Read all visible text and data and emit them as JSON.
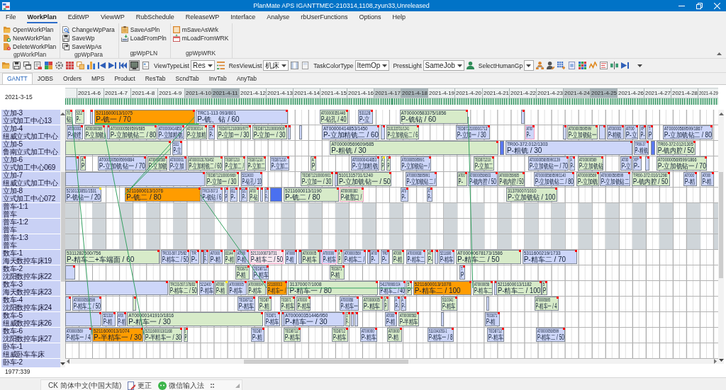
{
  "window": {
    "title": "PlanMate APS IGANTTMEC-210314,1108,zyun33,Unreleased"
  },
  "menu": [
    {
      "label": "File",
      "selected": false
    },
    {
      "label": "WorkPlan",
      "selected": true
    },
    {
      "label": "EditWP",
      "selected": false
    },
    {
      "label": "ViewWP",
      "selected": false
    },
    {
      "label": "RubSchedule",
      "selected": false
    },
    {
      "label": "ReleaseWP",
      "selected": false
    },
    {
      "label": "Interface",
      "selected": false
    },
    {
      "label": "Analyse",
      "selected": false
    },
    {
      "label": "rbUserFunctions",
      "selected": false
    },
    {
      "label": "Options",
      "selected": false
    },
    {
      "label": "Help",
      "selected": false
    }
  ],
  "ribbon": {
    "groups": [
      {
        "label": "gpWorkPlan",
        "items": [
          "OpenWorkPlan",
          "NewWorkPlan",
          "DeleteWorkPlan"
        ]
      },
      {
        "label": "gpWpPara",
        "items": [
          "ChangeWpPara",
          "SaveWp",
          "SaveWpAs"
        ]
      },
      {
        "label": "gpWpPLN",
        "items": [
          "SaveAsPln",
          "LoadFromPln"
        ]
      },
      {
        "label": "gpWpWRK",
        "items": [
          "mSaveAsWrk",
          "mLoadFromWRK"
        ]
      }
    ]
  },
  "toolbar": [
    {
      "kind": "icon",
      "pressed": false
    },
    {
      "kind": "icon",
      "pressed": false
    },
    {
      "kind": "icon",
      "pressed": false
    },
    {
      "kind": "icon",
      "pressed": false
    },
    {
      "kind": "icon",
      "pressed": false
    },
    {
      "kind": "icon",
      "pressed": false
    },
    {
      "kind": "icon",
      "pressed": false
    },
    {
      "kind": "icon",
      "pressed": false
    },
    {
      "kind": "icon",
      "pressed": false
    },
    {
      "kind": "icon",
      "pressed": false
    },
    {
      "kind": "icon",
      "pressed": false
    },
    {
      "kind": "icon",
      "pressed": false
    },
    {
      "kind": "icon",
      "pressed": true
    },
    {
      "kind": "icon",
      "pressed": false
    },
    {
      "kind": "combo",
      "label": "ViewTypeList",
      "value": "Res"
    },
    {
      "kind": "icon",
      "pressed": false
    },
    {
      "kind": "combo",
      "label": "ResViewList",
      "value": "机床"
    },
    {
      "kind": "icon",
      "pressed": false
    },
    {
      "kind": "icon",
      "pressed": false
    },
    {
      "kind": "combo",
      "label": "TaskColorType",
      "value": "ItemOp"
    },
    {
      "kind": "combo",
      "label": "PressLight",
      "value": "SameJob"
    },
    {
      "kind": "icon",
      "pressed": false
    },
    {
      "kind": "combo",
      "label": "SelectHumanGp"
    },
    {
      "kind": "icon",
      "pressed": false
    },
    {
      "kind": "icon",
      "pressed": false
    },
    {
      "kind": "icon",
      "pressed": false
    },
    {
      "kind": "icon",
      "pressed": false
    },
    {
      "kind": "icon",
      "pressed": false
    },
    {
      "kind": "icon",
      "pressed": false
    },
    {
      "kind": "icon",
      "pressed": false
    },
    {
      "kind": "icon",
      "pressed": false
    },
    {
      "kind": "icon",
      "pressed": false
    },
    {
      "kind": "overflow"
    }
  ],
  "tabs": [
    {
      "label": "GANTT",
      "selected": true
    },
    {
      "label": "JOBS",
      "selected": false
    },
    {
      "label": "Orders",
      "selected": false
    },
    {
      "label": "MPS",
      "selected": false
    },
    {
      "label": "Product",
      "selected": false
    },
    {
      "label": "ResTab",
      "selected": false
    },
    {
      "label": "ScndTab",
      "selected": false
    },
    {
      "label": "InvTab",
      "selected": false
    },
    {
      "label": "AnyTab",
      "selected": false
    }
  ],
  "gantt": {
    "base_date": "2021-3-15",
    "dates": [
      {
        "label": "2021-4-6"
      },
      {
        "label": "2021-4-7"
      },
      {
        "label": "2021-4-8"
      },
      {
        "label": "2021-4-9"
      },
      {
        "label": "2021-4-10",
        "shaded": true,
        "dark": false
      },
      {
        "label": "2021-4-11",
        "shaded": true,
        "dark": true
      },
      {
        "label": "2021-4-12"
      },
      {
        "label": "2021-4-13"
      },
      {
        "label": "2021-4-14"
      },
      {
        "label": "2021-4-15"
      },
      {
        "label": "2021-4-16"
      },
      {
        "label": "2021-4-17",
        "shaded": true,
        "dark": false
      },
      {
        "label": "2021-4-18",
        "shaded": true,
        "dark": true
      },
      {
        "label": "2021-4-19"
      },
      {
        "label": "2021-4-20"
      },
      {
        "label": "2021-4-21"
      },
      {
        "label": "2021-4-22"
      },
      {
        "label": "2021-4-23"
      },
      {
        "label": "2021-4-24",
        "shaded": true,
        "dark": false
      },
      {
        "label": "2021-4-25",
        "shaded": true,
        "dark": true
      },
      {
        "label": "2021-4-26"
      },
      {
        "label": "2021-4-27"
      },
      {
        "label": "2021-4-28"
      },
      {
        "label": "2021-4-29"
      }
    ],
    "resources": [
      {
        "code": "立加-3",
        "name": "立式加工中心13",
        "tasks": [
          {
            "id": "70",
            "op": "钻",
            "color": "#d7ebc9",
            "flag": {
              "color": "#ff0000"
            }
          },
          {
            "id": "5212",
            "op": "P-",
            "color": "#d7ebc9",
            "flag": {
              "color": "#ff0000"
            }
          },
          {
            "color": "#cdd6f9",
            "flag": {
              "color": "#ff0000"
            }
          },
          {
            "id": "5211600013/1075",
            "op": "P-铣一 / 70",
            "color": "#ff9c00",
            "flag": {
              "color": "#ff0000"
            }
          },
          {
            "id": "TRC1-113 093/801",
            "op": "P-铣、钻 / 60",
            "color": "#cdd6f9",
            "flag": {
              "color": "#ff0000"
            }
          },
          {
            "id": "AT00000351446",
            "op": "P-钻孔 / 40",
            "color": "#d7ebc9",
            "flag": {
              "color": "#ff0000"
            }
          },
          {
            "id": "531128",
            "op": "P-立",
            "color": "#cdd6f9",
            "flag": {
              "color": "#ff0000"
            }
          },
          {
            "id": "AT00000583375/1856",
            "op": "P-铣钻 / 60",
            "color": "#d7ebc9",
            "flag": {
              "color": "#ff0000"
            }
          },
          {
            "color": "#cdd6f9",
            "flag": {
              "color": "#ff0000"
            }
          }
        ]
      },
      {
        "code": "立加-4",
        "name": "纽威立式加工中心",
        "tasks": [
          {
            "id": "AT000003",
            "op": "P-铣镗",
            "color": "#cdd6f9",
            "flag": {
              "color": "#ff0000"
            }
          },
          {
            "id": "AT00000569",
            "op": "P-立加铣",
            "color": "#d7ebc9",
            "flag": {
              "color": "#ff0000"
            }
          },
          {
            "color": "#cdd6f9",
            "flag": {
              "color": "#ff0000"
            }
          },
          {
            "id": "AT00000569599/685",
            "op": "P-立加铣钻二 / 80",
            "color": "#d7ebc9",
            "flag": {
              "color": "#ff0000"
            }
          },
          {
            "id": "AT00000414853",
            "op": "P-立加精铣",
            "color": "#cdd6f9",
            "flag": {
              "color": "#ff0000"
            }
          },
          {
            "id": "AT0000014",
            "op": "P-立加精",
            "color": "#d7ebc9",
            "flag": {
              "color": "#ff0000"
            }
          },
          {
            "id": "531",
            "op": "P-",
            "color": "#cdd6f9",
            "flag": {
              "color": "#ff0000"
            }
          },
          {
            "id": "TED871210000/977",
            "op": "P-立加一 / 30",
            "color": "#d7ebc9",
            "flag": {
              "color": "#ff0000"
            }
          },
          {
            "id": "TED871210000/909",
            "op": "P-立加一 / 30",
            "color": "#d7ebc9",
            "flag": {
              "color": "#ff0000"
            }
          },
          {
            "color": "#cdd6f9",
            "flag": {
              "color": "#ff0000"
            }
          },
          {
            "color": "#cdd6f9"
          },
          {
            "id": "AT00000414853/1450",
            "op": "P-立加精铣二 / 60",
            "color": "#cdd6f9",
            "flag": {
              "color": "#ff0000"
            }
          },
          {
            "color": "#cdd6f9",
            "flag": {
              "color": "#ff0000"
            }
          },
          {
            "id": "5101315731/1241",
            "op": "P-立加铣钻二 / 6",
            "color": "#d7ebc9",
            "flag": {
              "color": "#ff0000"
            }
          },
          {
            "id": "TED871210000/1713",
            "op": "P-立加一 / 30",
            "color": "#cdd6f9",
            "flag": {
              "color": "#ff0000"
            }
          },
          {
            "id": "AT00",
            "op": "P-",
            "color": "#cdd6f9",
            "flag": {
              "color": "#ff0000"
            },
            "outlined": true
          },
          {
            "color": "#cdd6f9",
            "flag": {
              "color": "#ff0000"
            }
          },
          {
            "id": "AT00000569599/",
            "op": "P-立加铣钻一",
            "color": "#d7ebc9",
            "flag": {
              "color": "#ff0000"
            }
          },
          {
            "color": "#cdd6f9",
            "flag": {
              "color": "#ff0000"
            }
          },
          {
            "id": "AT000003",
            "op": "P-精铣",
            "color": "#cdd6f9",
            "flag": {
              "color": "#ff0000"
            }
          },
          {
            "id": "AT00",
            "op": "P-立",
            "color": "#cdd6f9",
            "flag": {
              "color": "#ff0000"
            }
          },
          {
            "id": "XP",
            "op": "P-",
            "color": "#cdd6f9",
            "flag": {
              "color": "#ff0000"
            }
          },
          {
            "id": "T",
            "op": "P",
            "color": "#cdd6f9",
            "flag": {
              "color": "#ff0000"
            }
          },
          {
            "id": "AT00000569599/1867",
            "op": "P-立加铣钻二 / 80",
            "color": "#cdd6f9",
            "flag": {
              "color": "#ff0000"
            }
          }
        ]
      },
      {
        "code": "立加-5",
        "name": "鲁南立式加工中心",
        "tasks": [
          {
            "color": "#d7ebc9",
            "flag": {
              "color": "#ff0000"
            }
          },
          {
            "id": "5311",
            "op": "P-立",
            "color": "#cdd6f9",
            "flag": {
              "color": "#ff0000"
            }
          },
          {
            "id": "AT00000569609/685",
            "op": "P-粗铣 / 30",
            "color": "#d7ebc9",
            "flag": {
              "color": "#ff0000"
            }
          },
          {
            "color": "#5a78f0"
          },
          {
            "id": "TR00-372.012/1303",
            "op": "P-粗铣 / 30",
            "color": "#cdd6f9",
            "flag": {
              "color": "#ff0000"
            }
          },
          {
            "id": "TR00-37",
            "op": "P-粗铣",
            "color": "#cdd6f9",
            "flag": {
              "color": "#ff0000"
            }
          },
          {
            "color": "#5a78f0"
          },
          {
            "id": "TR00-372.012/1305",
            "op": "P-铣内腔 / 50",
            "color": "#d7ebc9",
            "flag": {
              "color": "#ff0000"
            }
          }
        ]
      },
      {
        "code": "立加-6",
        "name": "立式加工中心069",
        "tasks": [
          {
            "color": "#cdd6f9",
            "flag": {
              "color": "#ff0000"
            }
          },
          {
            "id": "A",
            "op": "P",
            "color": "#d7ebc9",
            "flag": {
              "color": "#ff0000"
            }
          },
          {
            "id": "AT00000569599/884",
            "op": "P-立加铣钻一 / 70",
            "color": "#cdd6f9",
            "flag": {
              "color": "#ff0000"
            }
          },
          {
            "id": "AT00000569",
            "op": "P-立加铣",
            "color": "#d7ebc9",
            "flag": {
              "color": "#ff0000"
            }
          },
          {
            "id": "AT000001",
            "op": "P-立加",
            "color": "#cdd6f9",
            "flag": {
              "color": "#ff0000"
            }
          },
          {
            "id": "AT00000151793/452",
            "op": "P-立加精铣二 / 60",
            "color": "#d7ebc9",
            "flag": {
              "color": "#ff0000"
            }
          },
          {
            "id": "TED871210",
            "op": "P-立加二 /",
            "color": "#d7ebc9",
            "flag": {
              "color": "#ff0000"
            }
          },
          {
            "id": "TED871210",
            "op": "P-立加二",
            "color": "#d7ebc9",
            "flag": {
              "color": "#ff0000"
            }
          },
          {
            "id": "TED871210",
            "op": "P-立加二",
            "color": "#cdd6f9",
            "flag": {
              "color": "#ff0000"
            }
          },
          {
            "id": "A",
            "op": "P",
            "color": "#d7ebc9",
            "flag": {
              "color": "#ff0000"
            }
          },
          {
            "id": "AT00000414853",
            "op": "P-立加精铣",
            "color": "#cdd6f9",
            "flag": {
              "color": "#ff0000"
            }
          },
          {
            "id": "A",
            "op": "P",
            "color": "#d7ebc9",
            "flag": {
              "color": "#ffe100"
            }
          },
          {
            "id": "A",
            "op": "P",
            "color": "#d7ebc9",
            "flag": {
              "color": "#ff0000"
            }
          },
          {
            "id": "AT00000569599/1",
            "op": "P-立加铣钻一 /",
            "color": "#cdd6f9",
            "flag": {
              "color": "#ff0000"
            }
          },
          {
            "id": "TED871210",
            "op": "P-立加二",
            "color": "#d7ebc9",
            "flag": {
              "color": "#ff0000"
            }
          },
          {
            "id": "AT00000569599/1139",
            "op": "P-立加铣钻一 / 70",
            "color": "#cdd6f9",
            "flag": {
              "color": "#ff0000"
            }
          },
          {
            "id": "A",
            "op": "P-",
            "color": "#cdd6f9",
            "flag": {
              "color": "#ff0000"
            }
          },
          {
            "id": "AT00000569",
            "op": "P-立加铣钻",
            "color": "#d7ebc9",
            "flag": {
              "color": "#ff0000"
            }
          },
          {
            "id": "AT00",
            "op": "P-立",
            "color": "#cdd6f9",
            "flag": {
              "color": "#ff0000"
            }
          },
          {
            "id": "XP",
            "op": "P-",
            "color": "#cdd6f9",
            "flag": {
              "color": "#ff0000"
            }
          },
          {
            "color": "#cdd6f9",
            "flag": {
              "color": "#ff0000"
            }
          },
          {
            "id": "AT00000569599/1866",
            "op": "P-立加铣钻一 / 70",
            "color": "#d7ebc9",
            "flag": {
              "color": "#ff0000"
            }
          }
        ]
      },
      {
        "code": "立加-7",
        "name": "纽威立式加工中心",
        "tasks": [
          {
            "color": "#cdd6f9",
            "flag": {
              "color": "#ff0000"
            }
          },
          {
            "id": "TED871210000/969",
            "op": "P-立加一 / 30",
            "color": "#d7ebc9",
            "flag": {
              "color": "#ff0000"
            }
          },
          {
            "id": "52124000",
            "op": "P-钻孔 / 10",
            "color": "#cdd6f9",
            "flag": {
              "color": "#ff0000"
            }
          },
          {
            "id": "TED871210000/901",
            "op": "P-立加一 / 30",
            "color": "#d7ebc9",
            "flag": {
              "color": "#ff0000"
            }
          },
          {
            "color": "#cdd6f9",
            "flag": {
              "color": "#ff0000"
            }
          },
          {
            "id": "5101315731/1240",
            "op": "P-立加铣钻一 / 50",
            "color": "#d7ebc9",
            "flag": {
              "color": "#ff0000"
            }
          },
          {
            "id": "AT00000569599/1",
            "op": "P-立加铣钻二 /",
            "color": "#cdd6f9",
            "flag": {
              "color": "#ff0000"
            }
          },
          {
            "id": "AT00",
            "op": "P-",
            "color": "#d7ebc9",
            "flag": {
              "color": "#ff0000"
            }
          },
          {
            "id": "AT00000569603",
            "op": "P-铣内腔 / 50",
            "color": "#cdd6f9",
            "flag": {
              "color": "#ff0000"
            }
          },
          {
            "id": "AT00000569605",
            "op": "P-铣内腔 / 50",
            "color": "#d7ebc9",
            "flag": {
              "color": "#ff0000"
            }
          },
          {
            "id": "AT00000569599/1140",
            "op": "P-立加铣钻二 / 80",
            "color": "#cdd6f9",
            "flag": {
              "color": "#ff0000"
            }
          },
          {
            "id": "AT00000569",
            "op": "P-立加铣",
            "color": "#d7ebc9",
            "flag": {
              "color": "#ff0000"
            }
          },
          {
            "id": "AT00000569599",
            "op": "P-立加铣钻二",
            "color": "#cdd6f9",
            "flag": {
              "color": "#ff0000"
            }
          },
          {
            "id": "TR00-372.010/1298",
            "op": "P-铣内腔 / 50",
            "color": "#d7ebc9",
            "flag": {
              "color": "#ff0000"
            }
          },
          {
            "id": "AT000",
            "op": "P-精",
            "color": "#cdd6f9",
            "flag": {
              "color": "#ff0000"
            }
          },
          {
            "id": "AT000",
            "op": "P-精",
            "color": "#cdd6f9",
            "flag": {
              "color": "#ff0000"
            }
          }
        ]
      },
      {
        "code": "立加-8",
        "name": "立式加工中心072",
        "tasks": [
          {
            "id": "5210130851/1531",
            "op": "P-铣钻一 / 20",
            "color": "#cdd6f9",
            "flag": {
              "color": "#ffe100"
            }
          },
          {
            "id": "5211600013/1076",
            "op": "P-铣二 / 80",
            "color": "#ff9c00",
            "flag": {
              "color": "#ff0000"
            }
          },
          {
            "id": "TRC0-507.3",
            "op": "P-铣钻 / 6",
            "color": "#cdd6f9",
            "flag": {
              "color": "#ff0000"
            }
          },
          {
            "id": "8",
            "op": "P",
            "color": "#cdd6f9",
            "flag": {
              "color": "#ff0000"
            }
          },
          {
            "id": "811",
            "op": "P-",
            "color": "#cdd6f9",
            "flag": {
              "color": "#ff0000"
            }
          },
          {
            "color": "#cdd6f9",
            "flag": {
              "color": "#ff0000"
            }
          },
          {
            "id": "521",
            "op": "P-",
            "color": "#cdd6f9",
            "flag": {
              "color": "#ff0000"
            }
          },
          {
            "id": "AT00",
            "op": "P-钻",
            "color": "#d7ebc9",
            "flag": {
              "color": "#ff0000"
            }
          },
          {
            "color": "#cdd6f9",
            "flag": {
              "color": "#ff0000"
            }
          },
          {
            "id": "52",
            "op": "P-",
            "color": "#cdd6f9",
            "flag": {
              "color": "#ff0000"
            }
          },
          {
            "color": "#4a70f0"
          },
          {
            "id": "5211600013/1190",
            "op": "P-铣二 / 80",
            "color": "#d7ebc9",
            "flag": {
              "color": "#ff0000"
            }
          },
          {
            "id": "AT00000382",
            "op": "P-铣豁口 /",
            "color": "#d7ebc9",
            "flag": {
              "color": "#ff0000"
            },
            "outlined": true
          },
          {
            "id": "AT0",
            "op": "P-",
            "color": "#cdd6f9",
            "flag": {
              "color": "#ff0000"
            }
          },
          {
            "id": "AT",
            "op": "P-",
            "color": "#cdd6f9",
            "flag": {
              "color": "#ff0000"
            }
          },
          {
            "id": "31370007/1010",
            "op": "P-立加铣钻 / 100",
            "color": "#d7ebc9",
            "flag": {
              "color": "#ff0000"
            }
          }
        ]
      },
      {
        "code": "普车-1:1",
        "name": "普车",
        "off_shift": true
      },
      {
        "code": "普车-1:2",
        "name": "普车",
        "off_shift": true
      },
      {
        "code": "普车-1:3",
        "name": "普车",
        "off_shift": true
      },
      {
        "code": "数车-1",
        "name": "海天数控车床19",
        "tasks": [
          {
            "id": "5311282500/756",
            "op": "P-精车二+车端面 / 60",
            "color": "#d7ebc9",
            "flag": {
              "color": "#ff0000"
            }
          },
          {
            "id": "TRC03-507.375/82",
            "op": "P-精车二 / 50",
            "color": "#cdd6f9",
            "flag": {
              "color": "#ff0000"
            }
          },
          {
            "id": "TR",
            "op": "P-",
            "color": "#cdd6f9",
            "flag": {
              "color": "#ff0000"
            }
          },
          {
            "color": "#cdd6f9",
            "flag": {
              "color": "#ff0000"
            }
          },
          {
            "id": "31",
            "op": "P-",
            "color": "#cdd6f9",
            "flag": {
              "color": "#ff0000"
            }
          },
          {
            "id": "AT000",
            "op": "P-精",
            "color": "#cdd6f9",
            "flag": {
              "color": "#ff0000"
            }
          },
          {
            "id": "83144",
            "op": "P-精",
            "color": "#d7ebc9",
            "flag": {
              "color": "#ff0000"
            }
          },
          {
            "id": "AT000",
            "op": "P-精",
            "color": "#cdd6f9",
            "flag": {
              "color": "#ff0000"
            }
          },
          {
            "id": "5213100873/731",
            "op": "P-精车二 / 50",
            "color": "#f7e7ee",
            "flag": {
              "color": "#ff0000"
            },
            "outlined": true
          },
          {
            "id": "AT0000",
            "op": "P-精",
            "color": "#cdd6f9",
            "flag": {
              "color": "#ff0000"
            }
          },
          {
            "color": "#cdd6f9",
            "flag": {
              "color": "#ff0000"
            }
          },
          {
            "id": "AT000005",
            "op": "P-精车",
            "color": "#d7ebc9",
            "flag": {
              "color": "#ff0000"
            }
          },
          {
            "color": "#cdd6f9",
            "flag": {
              "color": "#ff0000"
            }
          },
          {
            "id": "AT00000",
            "op": "P-精车",
            "color": "#cdd6f9",
            "flag": {
              "color": "#ff0000"
            },
            "outlined": true
          },
          {
            "id": "A",
            "op": "P",
            "color": "#d7ebc9",
            "flag": {
              "color": "#ff0000"
            }
          },
          {
            "id": "AT00000569",
            "op": "P-精车二 /",
            "color": "#cdd6f9",
            "flag": {
              "color": "#ff0000"
            }
          },
          {
            "color": "#cdd6f9",
            "flag": {
              "color": "#ff0000"
            }
          },
          {
            "id": "AT00",
            "op": "P-",
            "color": "#cdd6f9",
            "flag": {
              "color": "#ff0000"
            }
          },
          {
            "id": "TR0",
            "op": "P-",
            "color": "#cdd6f9",
            "flag": {
              "color": "#ff0000"
            }
          },
          {
            "id": "AT000",
            "op": "P-精",
            "color": "#d7ebc9",
            "flag": {
              "color": "#ff0000"
            }
          },
          {
            "id": "AT0000038",
            "op": "P-精车二",
            "color": "#cdd6f9",
            "flag": {
              "color": "#ff0000"
            }
          },
          {
            "id": "AT",
            "op": "P-",
            "color": "#d7ebc9",
            "flag": {
              "color": "#ff0000"
            }
          },
          {
            "color": "#cdd6f9",
            "flag": {
              "color": "#ff0000"
            }
          },
          {
            "id": "5211600",
            "op": "P-精车",
            "color": "#cdd6f9",
            "flag": {
              "color": "#ff0000"
            }
          },
          {
            "id": "AT00000678173/1586",
            "op": "P-精车二 / 50",
            "color": "#d7ebc9",
            "flag": {
              "color": "#ff0000"
            }
          },
          {
            "id": "5311600219/1733",
            "op": "P-精车二 / 70",
            "color": "#cdd6f9",
            "flag": {
              "color": "#ff0000"
            }
          }
        ]
      },
      {
        "code": "数车-2",
        "name": "沈阳数控车床22",
        "tasks": [
          {
            "color": "#cdd6f9",
            "flag": {
              "color": "#ff0000"
            }
          },
          {
            "id": "TED871",
            "op": "P-精",
            "color": "#d7ebc9",
            "flag": {
              "color": "#ff0000"
            }
          },
          {
            "id": "TED8712",
            "op": "P-精车",
            "color": "#cdd6f9",
            "flag": {
              "color": "#ff0000"
            }
          },
          {
            "id": "TED871",
            "op": "P-精",
            "color": "#d7ebc9",
            "flag": {
              "color": "#ff0000"
            }
          },
          {
            "id": "T",
            "op": "P",
            "color": "#cdd6f9",
            "flag": {
              "color": "#ff0000"
            }
          }
        ]
      },
      {
        "code": "数车-3",
        "name": "海天数控车床23",
        "tasks": [
          {
            "color": "#cdd6f9",
            "flag": {
              "color": "#ff0000"
            }
          },
          {
            "id": "TRC03-507.376/83",
            "op": "P-精车二 / 50",
            "color": "#d7ebc9",
            "flag": {
              "color": "#ff0000"
            }
          },
          {
            "id": "5212400",
            "op": "P-精车",
            "color": "#cdd6f9",
            "flag": {
              "color": "#ff0000"
            }
          },
          {
            "id": "AT000",
            "op": "P-精",
            "color": "#d7ebc9",
            "flag": {
              "color": "#ffe100"
            }
          },
          {
            "id": "AT0000005",
            "op": "P-精车",
            "color": "#cdd6f9",
            "flag": {
              "color": "#ff0000"
            }
          },
          {
            "id": "AT0000004",
            "op": "P-精车",
            "color": "#d7ebc9",
            "flag": {
              "color": "#ff0000"
            }
          },
          {
            "id": "5211600013",
            "op": "P-精车一 /",
            "color": "#ff9c00",
            "flag": {
              "color": "#ff0000"
            }
          },
          {
            "id": "31370007/1008",
            "op": "P-精车一 / 80",
            "color": "#d7ebc9",
            "flag": {
              "color": "#ff0000"
            }
          },
          {
            "id": "5413700960/104",
            "op": "P-精车二 / 40",
            "color": "#cdd6f9",
            "flag": {
              "color": "#ff0000"
            }
          },
          {
            "id": "5",
            "op": "P",
            "color": "#d7ebc9",
            "flag": {
              "color": "#ff0000"
            }
          },
          {
            "id": "5211600013/1078",
            "op": "P-精车二 / 100",
            "color": "#ff9c00",
            "flag": {
              "color": "#ff0000"
            }
          },
          {
            "id": "AT0000056",
            "op": "P-精车二",
            "color": "#d7ebc9",
            "flag": {
              "color": "#ff0000"
            }
          },
          {
            "color": "#cdd6f9",
            "flag": {
              "color": "#ff0000"
            }
          },
          {
            "id": "5211600013/1182",
            "op": "P-精车二 / 100",
            "color": "#d7ebc9",
            "flag": {
              "color": "#ff0000"
            }
          },
          {
            "id": "5",
            "op": "P",
            "color": "#d7ebc9",
            "flag": {
              "color": "#ff0000"
            }
          }
        ]
      },
      {
        "code": "数车-4",
        "name": "沈阳数控车床24",
        "tasks": [
          {
            "color": "#cdd6f9",
            "flag": {
              "color": "#ff0000"
            }
          },
          {
            "id": "AT00000569599",
            "op": "P-精车二 / 50",
            "color": "#cdd6f9",
            "flag": {
              "color": "#ff0000"
            }
          },
          {
            "color": "#d7ebc9",
            "flag": {
              "color": "#ff0000"
            }
          },
          {
            "id": "TED8712",
            "op": "P-精车",
            "color": "#cdd6f9",
            "flag": {
              "color": "#ff0000"
            }
          },
          {
            "id": "TED87",
            "op": "P-精",
            "color": "#d7ebc9",
            "flag": {
              "color": "#ff0000"
            }
          },
          {
            "id": "TED871",
            "op": "P-精车",
            "color": "#d7ebc9",
            "flag": {
              "color": "#ff0000"
            }
          },
          {
            "id": "AT0000",
            "op": "P-精车",
            "color": "#d7ebc9",
            "flag": {
              "color": "#ff0000"
            }
          },
          {
            "id": "AT000056",
            "op": "P-精车一",
            "color": "#cdd6f9",
            "flag": {
              "color": "#ff0000"
            }
          },
          {
            "id": "AT000005",
            "op": "P-精车",
            "color": "#d7ebc9",
            "flag": {
              "color": "#ff0000"
            }
          },
          {
            "id": "A",
            "op": "P",
            "color": "#d7ebc9",
            "flag": {
              "color": "#ff0000"
            }
          },
          {
            "id": "A",
            "op": "P-",
            "color": "#cdd6f9",
            "flag": {
              "color": "#ff0000"
            }
          },
          {
            "id": "A",
            "op": "P-",
            "color": "#cdd6f9",
            "flag": {
              "color": "#ff0000"
            }
          },
          {
            "id": "5110341",
            "op": "P-精车",
            "color": "#d7ebc9",
            "flag": {
              "color": "#ff0000"
            }
          },
          {
            "color": "#cdd6f9"
          },
          {
            "id": "AT00005695",
            "op": "P-精车一 / 4",
            "color": "#d7ebc9",
            "flag": {
              "color": "#ff0000"
            }
          }
        ]
      },
      {
        "code": "数车-5",
        "name": "纽威数控车床26",
        "tasks": [
          {
            "color": "#cdd6f9",
            "flag": {
              "color": "#ff0000"
            }
          },
          {
            "id": "521310",
            "op": "P-精",
            "color": "#cdd6f9",
            "flag": {
              "color": "#ff0000"
            }
          },
          {
            "id": "AT00",
            "op": "P-精",
            "color": "#cdd6f9",
            "flag": {
              "color": "#ff0000"
            }
          },
          {
            "id": "AT00000141910/1816",
            "op": "P-精车一 / 30",
            "color": "#d7ebc9",
            "flag": {
              "color": "#ff0000"
            }
          },
          {
            "id": "TED871",
            "op": "P-精车",
            "color": "#cdd6f9",
            "flag": {
              "color": "#ff0000"
            }
          },
          {
            "color": "#cdd6f9",
            "flag": {
              "color": "#ff0000"
            }
          },
          {
            "id": "AT00000351446/950",
            "op": "P-精车一 / 30",
            "color": "#cdd6f9",
            "flag": {
              "color": "#ff0000"
            }
          },
          {
            "id": "31",
            "op": "P-",
            "color": "#d7ebc9",
            "flag": {
              "color": "#ff0000"
            }
          },
          {
            "color": "#cdd6f9",
            "flag": {
              "color": "#ff0000"
            }
          },
          {
            "color": "#cdd6f9",
            "flag": {
              "color": "#ff0000"
            }
          },
          {
            "id": "AT000",
            "op": "P-精",
            "color": "#cdd6f9",
            "flag": {
              "color": "#ff0000"
            }
          },
          {
            "id": "AT00000563",
            "op": "P-半精车",
            "color": "#d7ebc9",
            "flag": {
              "color": "#ff0000"
            }
          },
          {
            "color": "#cdd6f9"
          },
          {
            "id": "TED871",
            "op": "P-精",
            "color": "#cdd6f9",
            "flag": {
              "color": "#ff0000"
            }
          }
        ]
      },
      {
        "code": "数车-6",
        "name": "沈阳数控车床27",
        "tasks": [
          {
            "id": "AT00000569",
            "op": "P-精车一 / 4",
            "color": "#cdd6f9",
            "flag": {
              "color": "#ff0000"
            }
          },
          {
            "id": "5211600013/1074",
            "op": "P-半精车一 / 30",
            "color": "#ff9c00",
            "flag": {
              "color": "#ff0000"
            }
          },
          {
            "id": "5211600013/1168",
            "op": "P-半精车一 / 30",
            "color": "#d7ebc9",
            "flag": {
              "color": "#ff0000"
            }
          },
          {
            "id": "5",
            "op": "P",
            "color": "#d7ebc9",
            "flag": {
              "color": "#ff0000"
            }
          },
          {
            "id": "TED87",
            "op": "P-精",
            "color": "#cdd6f9",
            "flag": {
              "color": "#ff0000"
            }
          },
          {
            "id": "TED8712",
            "op": "P-精车",
            "color": "#d7ebc9",
            "flag": {
              "color": "#ff0000"
            }
          },
          {
            "id": "TED8712",
            "op": "P-精车",
            "color": "#d7ebc9",
            "flag": {
              "color": "#ff0000"
            }
          },
          {
            "id": "AT00000",
            "op": "P-精车",
            "color": "#cdd6f9",
            "flag": {
              "color": "#ff0000"
            }
          },
          {
            "id": "AT0000",
            "op": "P-精",
            "color": "#d7ebc9",
            "flag": {
              "color": "#ff0000"
            }
          },
          {
            "id": "5110341053-1",
            "op": "P-精车一 / 8",
            "color": "#cdd6f9",
            "flag": {
              "color": "#ff0000"
            }
          },
          {
            "id": "TED8712",
            "op": "P-精车",
            "color": "#cdd6f9",
            "flag": {
              "color": "#ff0000"
            }
          },
          {
            "id": "AT00000569599",
            "op": "P-精车二 / 50",
            "color": "#cdd6f9",
            "flag": {
              "color": "#ff0000"
            }
          }
        ]
      },
      {
        "code": "卧车-1",
        "name": "纽威卧车车床"
      },
      {
        "code": "卧车-2"
      }
    ],
    "counter": "1977:339"
  },
  "language_bar": [
    "CK 简体中文(中国大陆)",
    "更正",
    "微信输入法"
  ]
}
